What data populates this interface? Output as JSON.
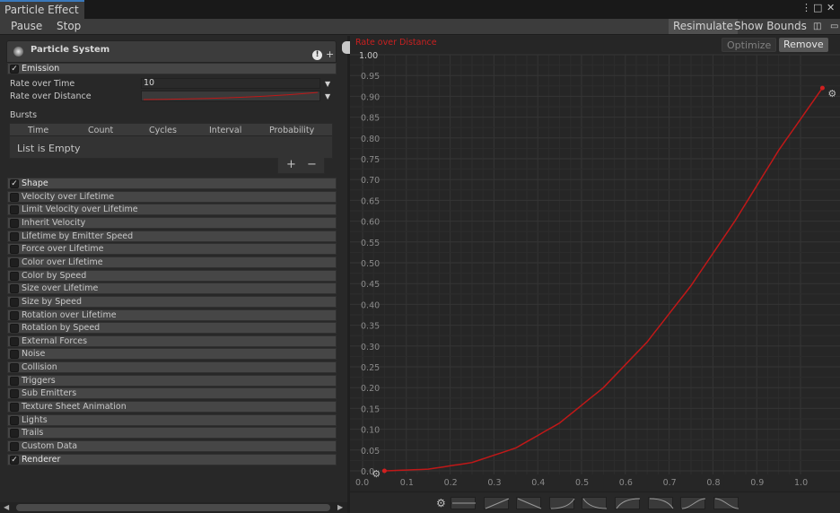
{
  "window": {
    "tab_title": "Particle Effect",
    "menu_icon": "⋮",
    "maximize_icon": "□",
    "close_icon": "✕"
  },
  "toolbar": {
    "pause": "Pause",
    "stop": "Stop",
    "resimulate": "Resimulate",
    "show_bounds": "Show Bounds"
  },
  "particle_system": {
    "title": "Particle System",
    "warn_glyph": "!",
    "add_glyph": "+"
  },
  "emission": {
    "label": "Emission",
    "rate_over_time_label": "Rate over Time",
    "rate_over_time_value": "10",
    "rate_over_distance_label": "Rate over Distance",
    "bursts_label": "Bursts",
    "columns": [
      "Time",
      "Count",
      "Cycles",
      "Interval",
      "Probability"
    ],
    "empty_text": "List is Empty",
    "add": "+",
    "remove": "−"
  },
  "modules": [
    {
      "label": "Shape",
      "checked": true
    },
    {
      "label": "Velocity over Lifetime",
      "checked": false
    },
    {
      "label": "Limit Velocity over Lifetime",
      "checked": false
    },
    {
      "label": "Inherit Velocity",
      "checked": false
    },
    {
      "label": "Lifetime by Emitter Speed",
      "checked": false
    },
    {
      "label": "Force over Lifetime",
      "checked": false
    },
    {
      "label": "Color over Lifetime",
      "checked": false
    },
    {
      "label": "Color by Speed",
      "checked": false
    },
    {
      "label": "Size over Lifetime",
      "checked": false
    },
    {
      "label": "Size by Speed",
      "checked": false
    },
    {
      "label": "Rotation over Lifetime",
      "checked": false
    },
    {
      "label": "Rotation by Speed",
      "checked": false
    },
    {
      "label": "External Forces",
      "checked": false
    },
    {
      "label": "Noise",
      "checked": false
    },
    {
      "label": "Collision",
      "checked": false
    },
    {
      "label": "Triggers",
      "checked": false
    },
    {
      "label": "Sub Emitters",
      "checked": false
    },
    {
      "label": "Texture Sheet Animation",
      "checked": false
    },
    {
      "label": "Lights",
      "checked": false
    },
    {
      "label": "Trails",
      "checked": false
    },
    {
      "label": "Custom Data",
      "checked": false
    },
    {
      "label": "Renderer",
      "checked": true
    }
  ],
  "curve_editor": {
    "title": "Rate over Distance",
    "optimize": "Optimize",
    "remove": "Remove",
    "y_top_label": "1.00",
    "y_ticks": [
      "0.95",
      "0.90",
      "0.85",
      "0.80",
      "0.75",
      "0.70",
      "0.65",
      "0.60",
      "0.55",
      "0.50",
      "0.45",
      "0.40",
      "0.35",
      "0.30",
      "0.25",
      "0.20",
      "0.15",
      "0.10",
      "0.05",
      "0.0"
    ],
    "x_ticks": [
      "0.0",
      "0.1",
      "0.2",
      "0.3",
      "0.4",
      "0.5",
      "0.6",
      "0.7",
      "0.8",
      "0.9",
      "1.0"
    ],
    "curve_color": "#c01818",
    "curve_points": [
      [
        0,
        0
      ],
      [
        0.1,
        0.004
      ],
      [
        0.2,
        0.02
      ],
      [
        0.3,
        0.055
      ],
      [
        0.4,
        0.115
      ],
      [
        0.5,
        0.2
      ],
      [
        0.6,
        0.31
      ],
      [
        0.7,
        0.445
      ],
      [
        0.8,
        0.6
      ],
      [
        0.9,
        0.77
      ],
      [
        1,
        0.92
      ]
    ]
  },
  "chart_data": {
    "type": "line",
    "title": "Rate over Distance",
    "xlabel": "",
    "ylabel": "",
    "xlim": [
      0,
      1
    ],
    "ylim": [
      0,
      1
    ],
    "x": [
      0,
      0.1,
      0.2,
      0.3,
      0.4,
      0.5,
      0.6,
      0.7,
      0.8,
      0.9,
      1.0
    ],
    "series": [
      {
        "values": [
          0,
          0.004,
          0.02,
          0.055,
          0.115,
          0.2,
          0.31,
          0.445,
          0.6,
          0.77,
          0.92
        ]
      }
    ],
    "grid": true
  }
}
